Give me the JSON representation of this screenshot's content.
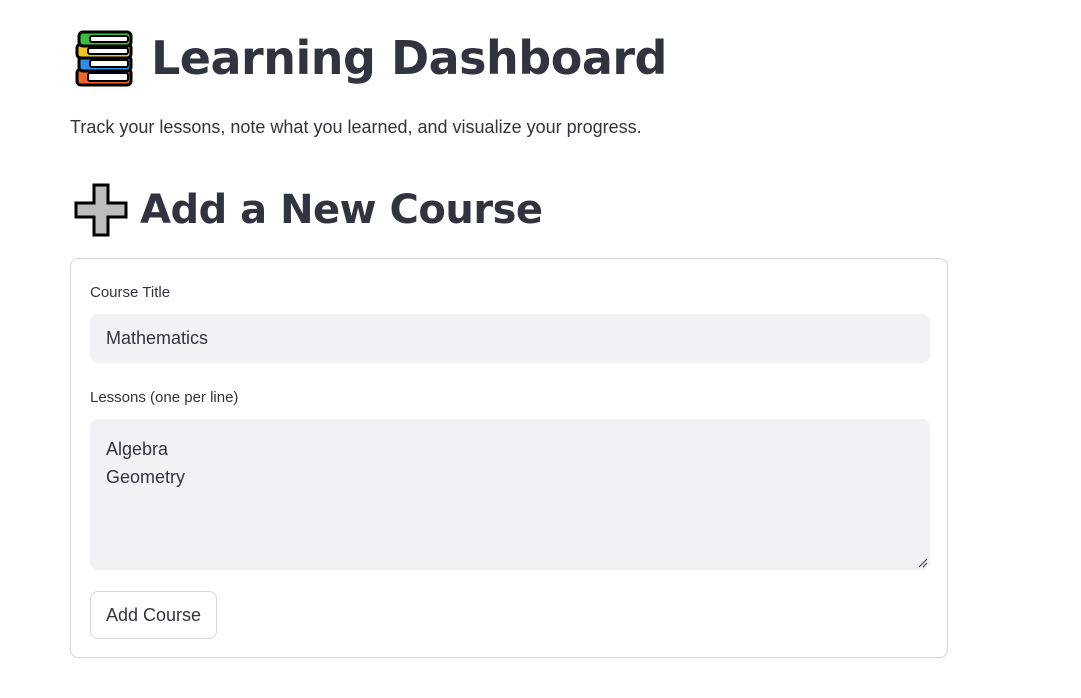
{
  "header": {
    "icon": "books-icon",
    "title": "Learning Dashboard",
    "subtitle": "Track your lessons, note what you learned, and visualize your progress."
  },
  "add_course_section": {
    "icon": "heavy-plus-icon",
    "title": "Add a New Course",
    "form": {
      "course_title_label": "Course Title",
      "course_title_value": "Mathematics",
      "lessons_label": "Lessons (one per line)",
      "lessons_lines": [
        "Algebra",
        "Geometry"
      ],
      "submit_label": "Add Course"
    }
  },
  "colors": {
    "text": "#31333f",
    "input_background": "#f0f2f6",
    "border": "#d6d6d9",
    "background": "#ffffff"
  }
}
